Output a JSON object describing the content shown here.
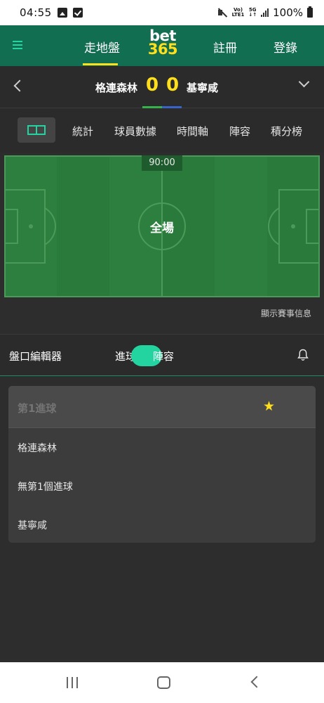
{
  "status_bar": {
    "time": "04:55",
    "network_top": "Vo)",
    "network_bottom": "LTE1",
    "five_g": "5G",
    "battery": "100%"
  },
  "header": {
    "menu_icon": "hamburger-icon",
    "in_play": "走地盤",
    "logo_top": "bet",
    "logo_bottom": "365",
    "register": "註冊",
    "login": "登錄"
  },
  "scoreboard": {
    "home_team": "格連森林",
    "home_score": "0",
    "away_score": "0",
    "away_team": "基寧咸",
    "home_color": "#36b24a",
    "away_color": "#3a63c9"
  },
  "tabs": {
    "pitch_icon": "pitch-icon",
    "items": [
      "統計",
      "球員數據",
      "時間軸",
      "陣容",
      "積分榜"
    ]
  },
  "pitch": {
    "clock": "90:00",
    "status": "全場",
    "show_info": "顯示賽事信息"
  },
  "market_bar": {
    "editor": "盤口編輯器",
    "toggle_left": "進球",
    "toggle_right": "陣容",
    "bell_icon": "bell-icon"
  },
  "market": {
    "title": "第1進球",
    "star_icon": "star-icon",
    "options": [
      "格連森林",
      "無第1個進球",
      "基寧咸"
    ]
  },
  "colors": {
    "brand_green": "#126e51",
    "accent_teal": "#23d3a0",
    "accent_yellow": "#ffdf1b",
    "pitch_green": "#2a7b3b"
  }
}
